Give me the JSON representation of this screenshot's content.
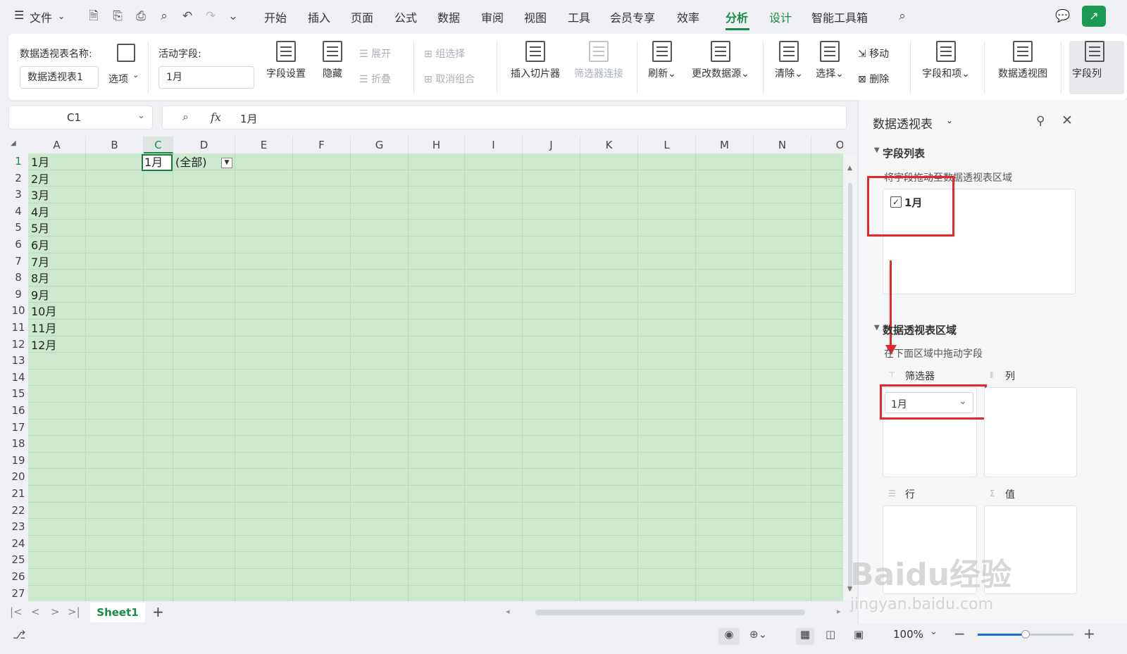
{
  "menubar": {
    "file": "文件",
    "tabs": [
      "开始",
      "插入",
      "页面",
      "公式",
      "数据",
      "审阅",
      "视图",
      "工具",
      "会员专享",
      "效率",
      "分析",
      "设计",
      "智能工具箱"
    ],
    "active_tab": "分析",
    "accent": "#1a8a4a"
  },
  "ribbon": {
    "pivot_name_label": "数据透视表名称:",
    "pivot_name_value": "数据透视表1",
    "options_label": "选项",
    "active_field_label": "活动字段:",
    "active_field_value": "1月",
    "field_settings": "字段设置",
    "hide": "隐藏",
    "expand": "展开",
    "collapse": "折叠",
    "group_select": "组选择",
    "ungroup": "取消组合",
    "insert_slicer": "插入切片器",
    "filter_conn": "筛选器连接",
    "refresh": "刷新",
    "change_source": "更改数据源",
    "clear": "清除",
    "select": "选择",
    "move": "移动",
    "delete": "删除",
    "fields_items": "字段和项",
    "pivot_chart": "数据透视图",
    "field_list": "字段列"
  },
  "formula": {
    "name_box": "C1",
    "fx": "fx",
    "content": "1月"
  },
  "sheet": {
    "columns": [
      "A",
      "B",
      "C",
      "D",
      "E",
      "F",
      "G",
      "H",
      "I",
      "J",
      "K",
      "L",
      "M",
      "N",
      "O"
    ],
    "rows": [
      "1",
      "2",
      "3",
      "4",
      "5",
      "6",
      "7",
      "8",
      "9",
      "10",
      "11",
      "12",
      "13",
      "14",
      "15",
      "16",
      "17",
      "18",
      "19",
      "20",
      "21",
      "22",
      "23",
      "24",
      "25",
      "26",
      "27"
    ],
    "colA": [
      "1月",
      "2月",
      "3月",
      "4月",
      "5月",
      "6月",
      "7月",
      "8月",
      "9月",
      "10月",
      "11月",
      "12月"
    ],
    "c1": "1月",
    "d1": "(全部)",
    "tab_name": "Sheet1",
    "grid_color": "#cce8cf"
  },
  "panel": {
    "title": "数据透视表",
    "field_list_header": "字段列表",
    "field_hint": "将字段拖动至数据透视表区域",
    "field_item": "1月",
    "areas_header": "数据透视表区域",
    "areas_hint": "在下面区域中拖动字段",
    "filter_label": "筛选器",
    "column_label": "列",
    "row_label": "行",
    "value_label": "值",
    "filter_value": "1月"
  },
  "status": {
    "zoom": "100%"
  },
  "watermark": {
    "text1": "Baidu经验",
    "text2": "jingyan.baidu.com"
  }
}
